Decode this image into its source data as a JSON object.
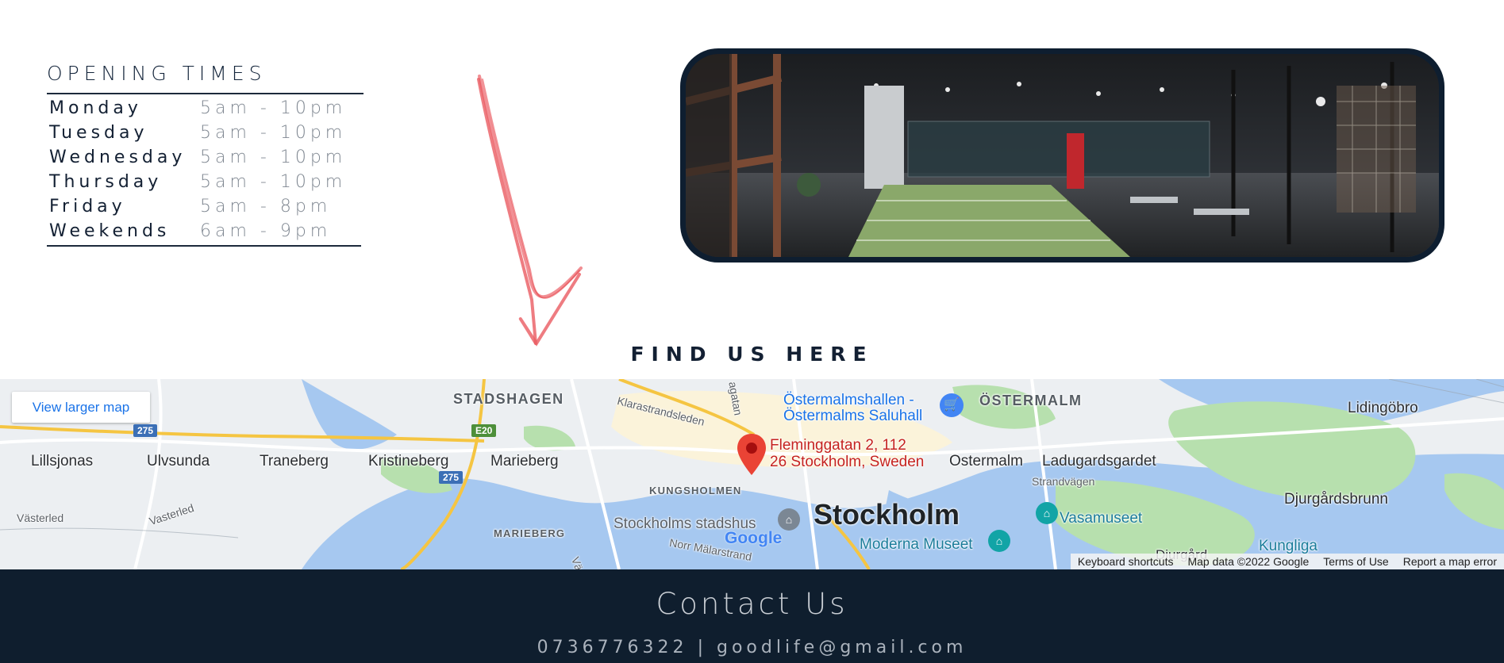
{
  "opening_times": {
    "title": "OPENING TIMES",
    "rows": [
      {
        "day": "Monday",
        "time": "5am - 10pm"
      },
      {
        "day": "Tuesday",
        "time": "5am - 10pm"
      },
      {
        "day": "Wednesday",
        "time": "5am - 10pm"
      },
      {
        "day": "Thursday",
        "time": "5am - 10pm"
      },
      {
        "day": "Friday",
        "time": "5am - 8pm"
      },
      {
        "day": "Weekends",
        "time": "6am - 9pm"
      }
    ]
  },
  "find_us": {
    "title": "FIND US HERE"
  },
  "map": {
    "view_larger_label": "View larger map",
    "districts": [
      "STADSHAGEN",
      "ÖSTERMALM",
      "KUNGSHOLMEN",
      "MARIEBERG"
    ],
    "towns": [
      "Lillsjonas",
      "Ulvsunda",
      "Traneberg",
      "Kristineberg",
      "Marieberg",
      "Ostermalm",
      "Ladugardsgardet",
      "Lidingöbro",
      "Djurgårdsbrunn"
    ],
    "streets": [
      "Klarastrandsleden",
      "agatan",
      "Västerled",
      "Vasterled",
      "Norr Mälarstrand",
      "Strandvägen",
      "Vä"
    ],
    "pois": [
      "Östermalmshallen - Östermalms Saluhall",
      "Stockholms stadshus",
      "Vasamuseet",
      "Moderna Museet",
      "Kungliga",
      "Djurgård"
    ],
    "city": "Stockholm",
    "shields": [
      "275",
      "E20",
      "275"
    ],
    "address_line1": "Fleminggatan 2, 112",
    "address_line2": "26 Stockholm, Sweden",
    "footer": {
      "keyboard": "Keyboard shortcuts",
      "map_data": "Map data ©2022 Google",
      "terms": "Terms of Use",
      "report": "Report a map error"
    },
    "logo": "Google"
  },
  "contact": {
    "title": "Contact Us",
    "phone": "0736776322",
    "separator": "|",
    "email": "goodlife@gmail.com"
  },
  "colors": {
    "navy": "#0f1e2e",
    "arrow": "#e8484f",
    "water": "#a6c8f0",
    "park": "#a8d8a0",
    "pin": "#ea4335"
  },
  "icons": [
    "arrow-doodle-icon",
    "map-pin-icon",
    "shopping-cart-icon",
    "museum-icon"
  ]
}
